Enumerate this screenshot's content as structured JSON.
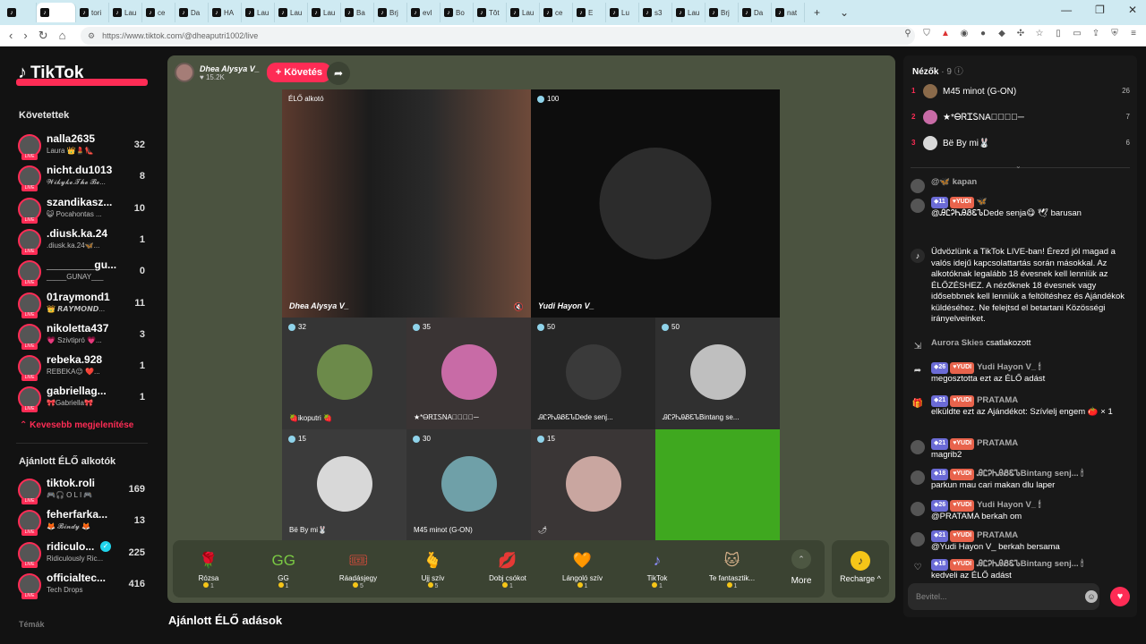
{
  "browser": {
    "tabs": [
      {
        "label": "",
        "active": false
      },
      {
        "label": "",
        "active": true
      },
      {
        "label": "tori",
        "active": false
      },
      {
        "label": "Lau",
        "active": false
      },
      {
        "label": "ce",
        "active": false
      },
      {
        "label": "Da",
        "active": false
      },
      {
        "label": "HA",
        "active": false
      },
      {
        "label": "Lau",
        "active": false
      },
      {
        "label": "Lau",
        "active": false
      },
      {
        "label": "Lau",
        "active": false
      },
      {
        "label": "Ba",
        "active": false
      },
      {
        "label": "Brj",
        "active": false
      },
      {
        "label": "evl",
        "active": false
      },
      {
        "label": "Bo",
        "active": false
      },
      {
        "label": "Tôt",
        "active": false
      },
      {
        "label": "Lau",
        "active": false
      },
      {
        "label": "ce",
        "active": false
      },
      {
        "label": "E",
        "active": false
      },
      {
        "label": "Lu",
        "active": false
      },
      {
        "label": "s3",
        "active": false
      },
      {
        "label": "Lau",
        "active": false
      },
      {
        "label": "Brj",
        "active": false
      },
      {
        "label": "Da",
        "active": false
      },
      {
        "label": "nat",
        "active": false
      }
    ],
    "url": "https://www.tiktok.com/@dheaputri1002/live"
  },
  "sidebar": {
    "logo": "TikTok",
    "following_title": "Követettek",
    "following": [
      {
        "name": "nalla2635",
        "sub": "Laura 👑💄👠",
        "count": "32"
      },
      {
        "name": "nicht.du1013",
        "sub": "𝓦𝓲𝓴𝔂𝓴𝓮.𝓣𝓱𝓮 𝓑𝓮...",
        "count": "8"
      },
      {
        "name": "szandikasz...",
        "sub": "😺 Pocahontas ...",
        "count": "10"
      },
      {
        "name": ".diusk.ka.24",
        "sub": ".diusk.ka.24🦋...",
        "count": "1"
      },
      {
        "name": "________gu...",
        "sub": "_____GUNAY___",
        "count": "0"
      },
      {
        "name": "01raymond1",
        "sub": "👑 𝙍𝘼𝙔𝙈𝙊𝙉𝘿...",
        "count": "11"
      },
      {
        "name": "nikoletta437",
        "sub": "💗 Szivtipró 💗...",
        "count": "3"
      },
      {
        "name": "rebeka.928",
        "sub": "REBEKA😉 ❤️...",
        "count": "1"
      },
      {
        "name": "gabriellag...",
        "sub": "🎀Gabriella🎀",
        "count": "1"
      }
    ],
    "show_less": "Kevesebb megjelenítése",
    "recommended_title": "Ajánlott ÉLŐ alkotók",
    "recommended": [
      {
        "name": "tiktok.roli",
        "sub": "🎮🎧 O L I 🎮",
        "count": "169"
      },
      {
        "name": "feherfarka...",
        "sub": "🦊 𝓑𝓲𝓷𝓭𝔂 🦊",
        "count": "13"
      },
      {
        "name": "ridiculo...",
        "sub": "Ridiculously Ric...",
        "count": "225",
        "verified": true
      },
      {
        "name": "officialtec...",
        "sub": "Tech Drops",
        "count": "416"
      }
    ],
    "bottom_label": "Témák"
  },
  "stream": {
    "host_name": "Dhea Alysya V_",
    "host_likes": "15.2K",
    "follow_label": "+ Követés",
    "creator_label": "ÉLŐ alkotó",
    "cells": [
      {
        "name": "Dhea Alysya V_",
        "score": ""
      },
      {
        "name": "Yudi Hayon V_",
        "score": "100"
      },
      {
        "name": "🍓ikoputri 🍓",
        "score": "32"
      },
      {
        "name": "★*ᎾᏒᏆᏚNA✧⃝✗⃝─",
        "score": "35"
      },
      {
        "name": "ᎯᏝᎮᏂᎯᏰᏋᏖDede senj...",
        "score": "50"
      },
      {
        "name": "ᎯᏝᎮᏂᎯᏰᏋᏖBintang se...",
        "score": "50"
      },
      {
        "name": "Bë By mi🐰",
        "score": "15"
      },
      {
        "name": "M45 minot (G-ON)",
        "score": "30"
      },
      {
        "name": "🌶",
        "score": "15"
      },
      {
        "name": "",
        "score": ""
      }
    ],
    "gifts": [
      {
        "label": "Rózsa",
        "price": "1",
        "icon": "🌹"
      },
      {
        "label": "GG",
        "price": "1",
        "icon": "GG"
      },
      {
        "label": "Ráadásjegy",
        "price": "5",
        "icon": "🎟"
      },
      {
        "label": "Ujj szív",
        "price": "5",
        "icon": "🫰"
      },
      {
        "label": "Dobj csókot",
        "price": "1",
        "icon": "💋"
      },
      {
        "label": "Lángoló szív",
        "price": "1",
        "icon": "🧡"
      },
      {
        "label": "TikTok",
        "price": "1",
        "icon": "♪"
      },
      {
        "label": "Te fantasztik...",
        "price": "1",
        "icon": "🐱"
      }
    ],
    "more_label": "More",
    "recharge_label": "Recharge ^",
    "recommended_live_title": "Ajánlott ÉLŐ adások"
  },
  "viewers": {
    "title": "Nézők",
    "count": "· 9",
    "top": [
      {
        "rank": "1",
        "name": "M45 minot (G-ON)",
        "score": "26"
      },
      {
        "rank": "2",
        "name": "★*ᎾᏒᏆᏚNA✧⃝✗⃝─",
        "score": "7"
      },
      {
        "rank": "3",
        "name": "Bë By mi🐰",
        "score": "6"
      }
    ]
  },
  "chat": {
    "messages": [
      {
        "level": "",
        "fan": "",
        "user": "@🦋 kapan",
        "text": ""
      },
      {
        "level": "11",
        "fan": "YUDI",
        "user": "🦋",
        "text": "@ᎯᏝᎮᏂᎯᏰᏋᏖDede senja😋 🕊 barusan"
      },
      {
        "level": "",
        "fan": "",
        "user": "",
        "text": "Üdvözlünk a TikTok LIVE-ban! Érezd jól magad a valós idejű kapcsolattartás során másokkal. Az alkotóknak legalább 18 évesnek kell lenniük az ÉLŐZÉSHEZ. A nézőknek 18 évesnek vagy idősebbnek kell lenniük a feltöltéshez és Ajándékok küldéséhez. Ne felejtsd el betartani Közösségi irányelveinket."
      },
      {
        "level": "",
        "fan": "",
        "user": "Aurora Skies",
        "text": "csatlakozott"
      },
      {
        "level": "26",
        "fan": "YUDI",
        "user": "Yudi Hayon V_ 🕯",
        "text": "megosztotta ezt az ÉLŐ adást"
      },
      {
        "level": "21",
        "fan": "YUDI",
        "user": "PRATAMA",
        "text": "elküldte ezt az Ajándékot: Szívlelj engem 🍅 × 1"
      },
      {
        "level": "21",
        "fan": "YUDI",
        "user": "PRATAMA",
        "text": "magrib2"
      },
      {
        "level": "18",
        "fan": "YUDI",
        "user": "ᎯᏝᎮᏂᎯᏰᏋᏖBintang senj... 🕯",
        "text": "parkun mau cari makan dlu laper"
      },
      {
        "level": "26",
        "fan": "YUDI",
        "user": "Yudi Hayon V_ 🕯",
        "text": "@PRATAMA berkah om"
      },
      {
        "level": "21",
        "fan": "YUDI",
        "user": "PRATAMA",
        "text": "@Yudi Hayon V_ berkah bersama"
      },
      {
        "level": "18",
        "fan": "YUDI",
        "user": "ᎯᏝᎮᏂᎯᏰᏋᏖBintang senj... 🕯",
        "text": "kedveli az ÉLŐ adást"
      }
    ],
    "input_placeholder": "Bevitel..."
  }
}
